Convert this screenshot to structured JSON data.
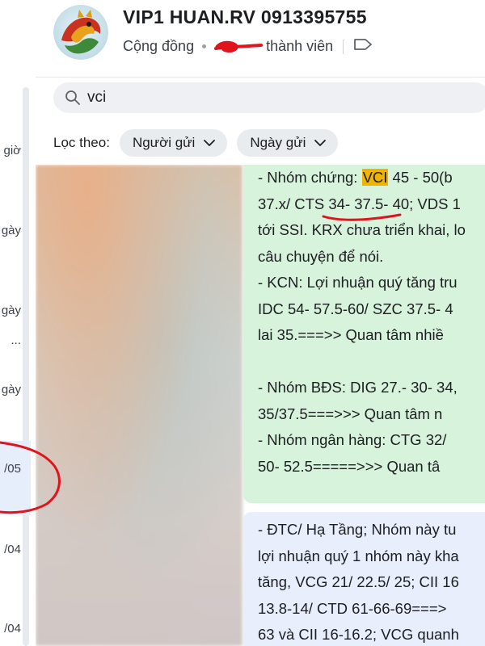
{
  "header": {
    "title": "VIP1 HUAN.RV 0913395755",
    "community_label": "Cộng đồng",
    "members_label": "thành viên"
  },
  "sidebar": {
    "fragments": [
      "giờ",
      "gày",
      "gày",
      "...",
      "gày",
      "/05",
      "/04",
      "/04"
    ]
  },
  "search": {
    "value": "vci"
  },
  "filters": {
    "label": "Lọc theo:",
    "sender_label": "Người gửi",
    "date_label": "Ngày gửi"
  },
  "results": {
    "message1": {
      "lines": [
        [
          "- Nhóm chứng: ",
          "VCI",
          " 45 - 50(b"
        ],
        "37.x/ CTS 34- 37.5- 40; VDS 1",
        "tới SSI. KRX chưa triển khai, lo",
        "câu chuyện để nói.",
        "- KCN: Lợi nhuận quý tăng tru",
        "IDC 54- 57.5-60/ SZC 37.5- 4",
        "lai 35.===>> Quan tâm nhiề",
        "",
        "- Nhóm BĐS: DIG 27.- 30- 34,",
        "35/37.5===>>> Quan tâm n",
        "- Nhóm ngân hàng: CTG 32/",
        "50- 52.5=====>>> Quan tâ"
      ]
    },
    "message2": {
      "lines": [
        "- ĐTC/ Hạ Tầng; Nhóm này tu",
        "lợi nhuận quý 1 nhóm này kha",
        "tăng, VCG 21/ 22.5/ 25;  CII 16",
        "13.8-14/ CTD 61-66-69===>",
        "63 và CII 16-16.2; VCG quanh"
      ]
    }
  },
  "colors": {
    "highlight": "#f0b400",
    "message_green": "#d7f3dc",
    "message_blue": "#e8eefc",
    "annotation_red": "#e0141c"
  }
}
